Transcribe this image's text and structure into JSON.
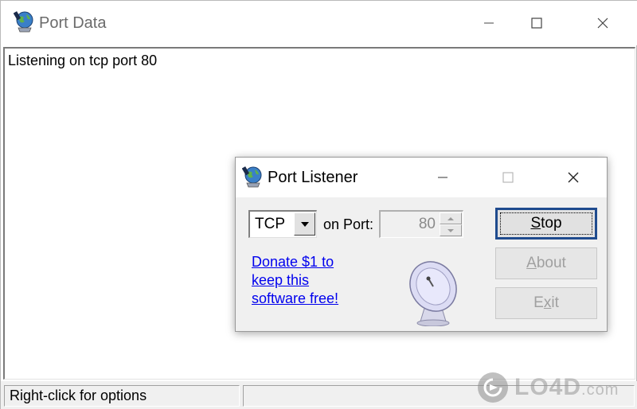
{
  "main_window": {
    "title": "Port Data",
    "controls": {
      "minimize": "minimize",
      "maximize": "maximize",
      "close": "close"
    },
    "log_lines": [
      "Listening on tcp port 80"
    ],
    "status_text": "Right-click for options"
  },
  "dialog": {
    "title": "Port Listener",
    "protocol": {
      "selected": "TCP"
    },
    "port_label": "on Port:",
    "port_value": "80",
    "donate_lines": [
      "Donate $1 to",
      "keep this",
      "software free!"
    ],
    "buttons": {
      "stop": {
        "prefix": "",
        "hotkey": "S",
        "rest": "top"
      },
      "about": {
        "prefix": "",
        "hotkey": "A",
        "rest": "bout"
      },
      "exit": {
        "prefix": "E",
        "hotkey": "x",
        "rest": "it"
      }
    }
  },
  "watermark": {
    "brand": "LO4D",
    "suffix": ".com"
  },
  "icons": {
    "app": "port-globe-icon",
    "dish": "satellite-dish-icon",
    "dropdown": "chevron-down-icon",
    "spin_up": "arrow-up-icon",
    "spin_down": "arrow-down-icon"
  },
  "colors": {
    "link": "#0000ee",
    "focus_border": "#1f4b8e",
    "disabled_text": "#a0a0a0"
  }
}
